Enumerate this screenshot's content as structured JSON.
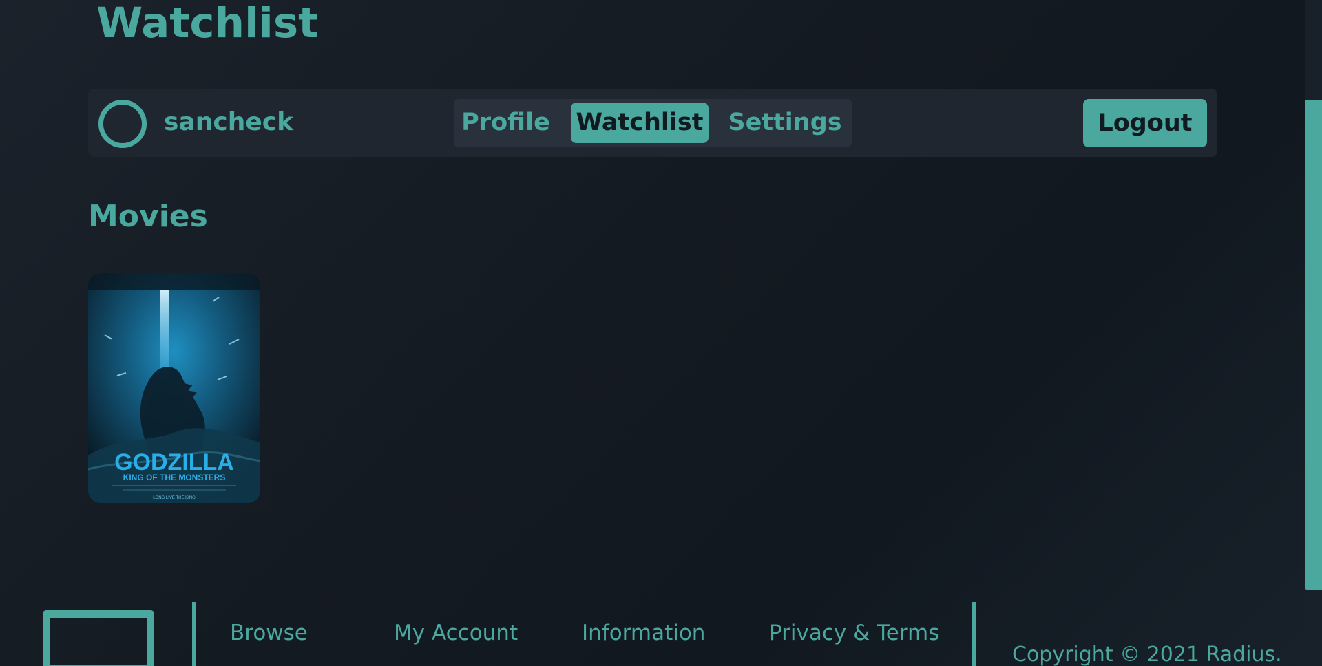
{
  "page": {
    "title": "Watchlist"
  },
  "account": {
    "username": "sancheck",
    "logout_label": "Logout"
  },
  "tabs": [
    {
      "label": "Profile",
      "active": false
    },
    {
      "label": "Watchlist",
      "active": true
    },
    {
      "label": "Settings",
      "active": false
    }
  ],
  "movies": {
    "heading": "Movies",
    "items": [
      {
        "title_line1": "GODZILLA",
        "title_line2": "KING OF THE MONSTERS",
        "tagline": "LONG LIVE THE KING"
      }
    ]
  },
  "footer": {
    "links": [
      "Browse",
      "My Account",
      "Information",
      "Privacy & Terms"
    ],
    "copyright": "Copyright © 2021 Radius."
  },
  "colors": {
    "accent": "#4aa89f",
    "background": "#141a21",
    "panel": "#1f2630"
  },
  "icons": {
    "avatar": "avatar-circle-icon",
    "logo": "radius-logo"
  }
}
